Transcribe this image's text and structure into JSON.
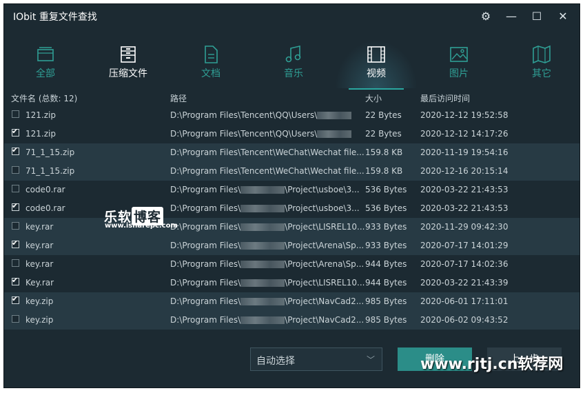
{
  "app": {
    "title": "IObit 重复文件查找"
  },
  "window_controls": [
    "settings-icon",
    "minimize-icon",
    "maximize-icon",
    "close-icon"
  ],
  "tabs": [
    {
      "label": "全部",
      "icon": "all-files-icon"
    },
    {
      "label": "压缩文件",
      "icon": "archive-icon",
      "selected": false
    },
    {
      "label": "文档",
      "icon": "document-icon"
    },
    {
      "label": "音乐",
      "icon": "music-icon"
    },
    {
      "label": "视频",
      "icon": "video-icon",
      "selected": true
    },
    {
      "label": "图片",
      "icon": "image-icon"
    },
    {
      "label": "其它",
      "icon": "other-icon"
    }
  ],
  "list": {
    "headers": {
      "name": "文件名 (总数: 12)",
      "path": "路径",
      "size": "大小",
      "time": "最后访问时间"
    },
    "rows": [
      {
        "checked": false,
        "name": "121.zip",
        "path_prefix": "D:\\Program Files\\Tencent\\QQ\\Users\\",
        "path_suffix": "",
        "size": "22 Bytes",
        "time": "2020-12-12 19:52:58"
      },
      {
        "checked": true,
        "name": "121.zip",
        "path_prefix": "D:\\Program Files\\Tencent\\QQ\\Users\\",
        "path_suffix": "",
        "size": "22 Bytes",
        "time": "2020-12-12 14:17:26"
      },
      {
        "checked": true,
        "name": "71_1_15.zip",
        "path_prefix": "D:\\Program Files\\Tencent\\WeChat\\Wechat file...",
        "path_suffix": null,
        "size": "159.8 KB",
        "time": "2020-11-19 19:54:16"
      },
      {
        "checked": false,
        "name": "71_1_15.zip",
        "path_prefix": "D:\\Program Files\\Tencent\\WeChat\\Wechat file...",
        "path_suffix": null,
        "size": "159.8 KB",
        "time": "2020-12-16 20:15:14"
      },
      {
        "checked": false,
        "name": "code0.rar",
        "path_prefix": "D:\\Program Files\\",
        "path_suffix": "\\Project\\usboe\\3...",
        "size": "536 Bytes",
        "time": "2020-03-22 21:43:53"
      },
      {
        "checked": true,
        "name": "code0.rar",
        "path_prefix": "D:\\Program Files\\",
        "path_suffix": "\\Project\\usboe\\3...",
        "size": "536 Bytes",
        "time": "2020-03-22 21:43:53"
      },
      {
        "checked": false,
        "name": "key.rar",
        "path_prefix": "D:\\Program Files\\",
        "path_suffix": "\\Project\\LISREL10...",
        "size": "933 Bytes",
        "time": "2020-11-29 09:42:30"
      },
      {
        "checked": true,
        "name": "key.rar",
        "path_prefix": "D:\\Program Files\\",
        "path_suffix": "\\Project\\Arena\\Sp...",
        "size": "933 Bytes",
        "time": "2020-07-17 14:01:29"
      },
      {
        "checked": false,
        "name": "key.rar",
        "path_prefix": "D:\\Program Files\\",
        "path_suffix": "\\Project\\Arena\\Sp...",
        "size": "944 Bytes",
        "time": "2020-07-17 14:02:36"
      },
      {
        "checked": true,
        "name": "Key.rar",
        "path_prefix": "D:\\Program Files\\",
        "path_suffix": "\\Project\\LISREL10...",
        "size": "944 Bytes",
        "time": "2020-03-22 21:43:39"
      },
      {
        "checked": true,
        "name": "key.zip",
        "path_prefix": "D:\\Program Files\\",
        "path_suffix": "\\Project\\NavCad2...",
        "size": "985 Bytes",
        "time": "2020-06-01 17:11:01"
      },
      {
        "checked": false,
        "name": "key.zip",
        "path_prefix": "D:\\Program Files\\",
        "path_suffix": "\\Project\\NavCad2...",
        "size": "985 Bytes",
        "time": "2020-06-02 09:43:52"
      }
    ]
  },
  "footer": {
    "select_value": "自动选择",
    "primary_button": "删除",
    "secondary_button": "上一步"
  },
  "watermarks": {
    "site1_a": "乐软",
    "site1_b": "博客",
    "site1_url": "www.isharepc.com",
    "site2": "www.rjtj.cn软荐网"
  },
  "colors": {
    "background": "#1c2a32",
    "alt_row": "#273a44",
    "accent": "#2aa7a0"
  }
}
